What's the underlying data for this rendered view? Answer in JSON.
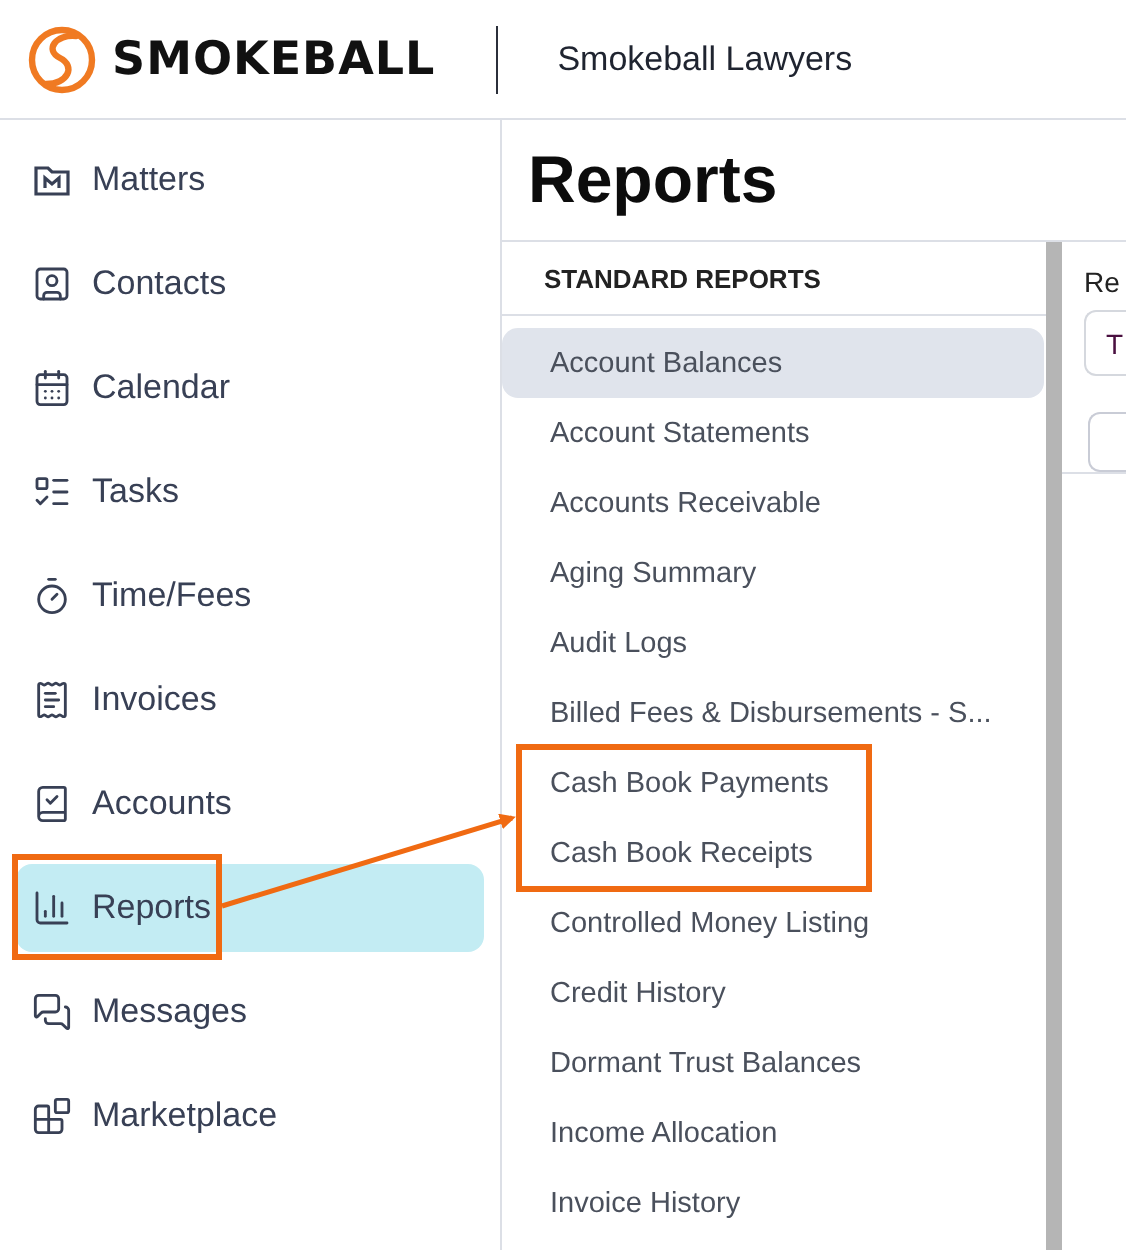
{
  "header": {
    "brand": "SMOKEBALL",
    "firm": "Smokeball Lawyers"
  },
  "nav": [
    {
      "label": "Matters",
      "selected": false,
      "highlighted": false
    },
    {
      "label": "Contacts",
      "selected": false,
      "highlighted": false
    },
    {
      "label": "Calendar",
      "selected": false,
      "highlighted": false
    },
    {
      "label": "Tasks",
      "selected": false,
      "highlighted": false
    },
    {
      "label": "Time/Fees",
      "selected": false,
      "highlighted": false
    },
    {
      "label": "Invoices",
      "selected": false,
      "highlighted": false
    },
    {
      "label": "Accounts",
      "selected": false,
      "highlighted": false
    },
    {
      "label": "Reports",
      "selected": true,
      "highlighted": true
    },
    {
      "label": "Messages",
      "selected": false,
      "highlighted": false
    },
    {
      "label": "Marketplace",
      "selected": false,
      "highlighted": false
    }
  ],
  "page_title": "Reports",
  "reports": {
    "heading": "STANDARD REPORTS",
    "items": [
      {
        "label": "Account Balances",
        "selected": true,
        "highlighted": false
      },
      {
        "label": "Account Statements",
        "selected": false,
        "highlighted": false
      },
      {
        "label": "Accounts Receivable",
        "selected": false,
        "highlighted": false
      },
      {
        "label": "Aging Summary",
        "selected": false,
        "highlighted": false
      },
      {
        "label": "Audit Logs",
        "selected": false,
        "highlighted": false
      },
      {
        "label": "Billed Fees & Disbursements - S...",
        "selected": false,
        "highlighted": false
      },
      {
        "label": "Cash Book Payments",
        "selected": false,
        "highlighted": true
      },
      {
        "label": "Cash Book Receipts",
        "selected": false,
        "highlighted": true
      },
      {
        "label": "Controlled Money Listing",
        "selected": false,
        "highlighted": false
      },
      {
        "label": "Credit History",
        "selected": false,
        "highlighted": false
      },
      {
        "label": "Dormant Trust Balances",
        "selected": false,
        "highlighted": false
      },
      {
        "label": "Income Allocation",
        "selected": false,
        "highlighted": false
      },
      {
        "label": "Invoice History",
        "selected": false,
        "highlighted": false
      }
    ]
  },
  "detail": {
    "label": "Re",
    "field_value": "T"
  }
}
